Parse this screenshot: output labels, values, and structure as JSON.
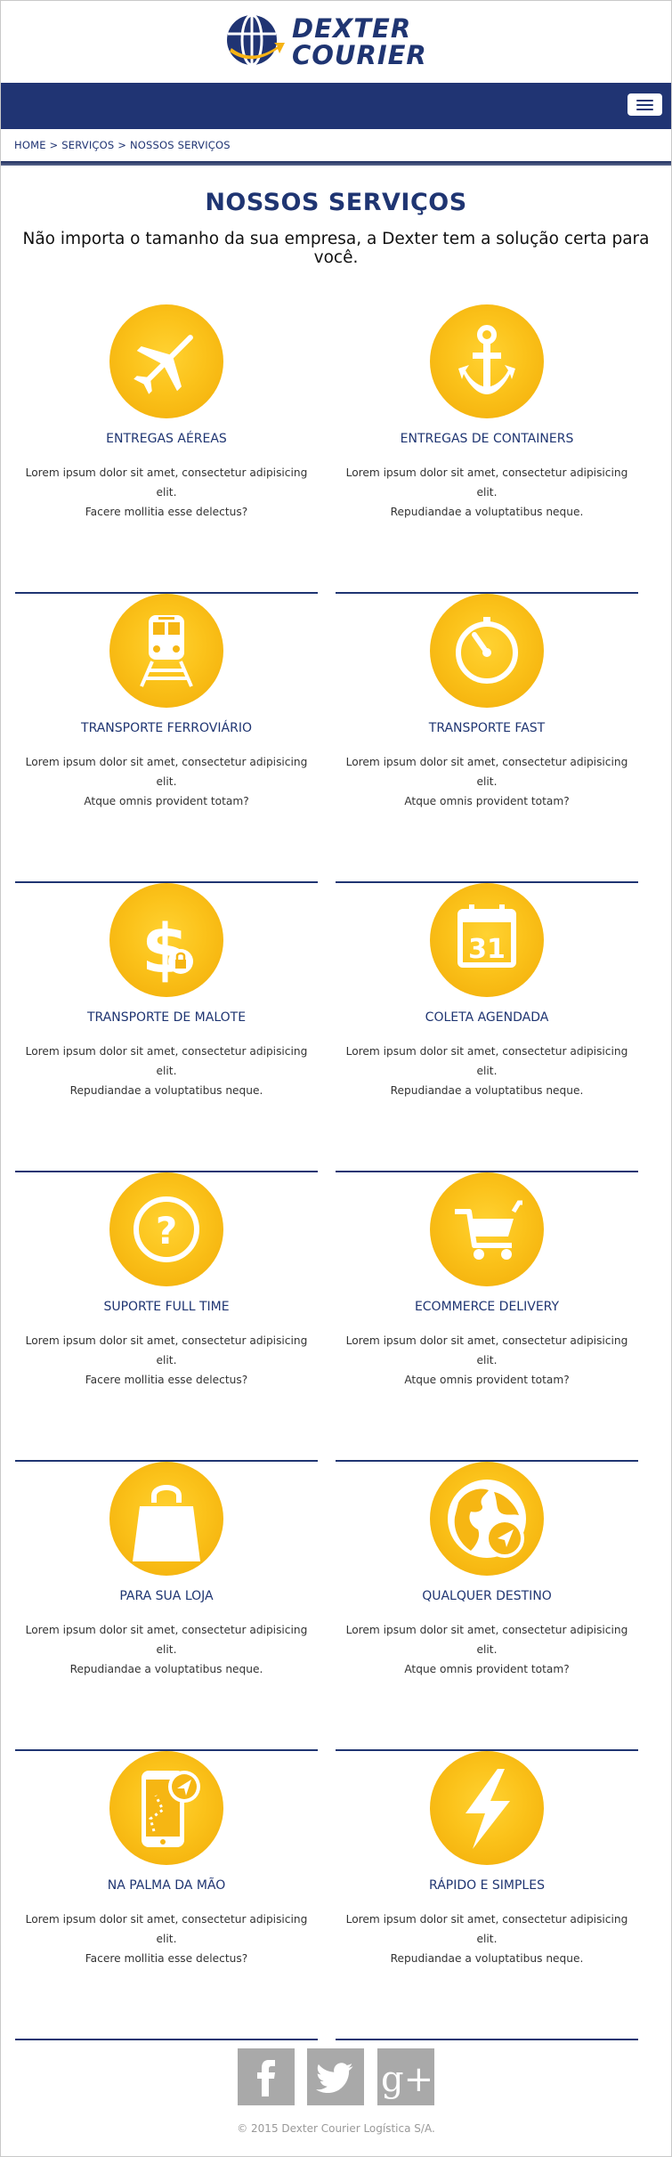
{
  "header": {
    "logo_line1": "DEXTER",
    "logo_line2": "COURIER",
    "menu_icon": "hamburger-icon"
  },
  "breadcrumb": "HOME > SERVIÇOS > NOSSOS SERVIÇOS",
  "main": {
    "title": "NOSSOS SERVIÇOS",
    "subtitle": "Não importa o tamanho da sua empresa, a Dexter tem a solução certa para você."
  },
  "services": [
    {
      "title": "ENTREGAS AÉREAS",
      "desc1": "Lorem ipsum dolor sit amet, consectetur adipisicing elit.",
      "desc2": "Facere mollitia esse delectus?",
      "icon": "airplane-icon"
    },
    {
      "title": "ENTREGAS DE CONTAINERS",
      "desc1": "Lorem ipsum dolor sit amet, consectetur adipisicing elit.",
      "desc2": "Repudiandae a voluptatibus neque.",
      "icon": "anchor-icon"
    },
    {
      "title": "TRANSPORTE FERROVIÁRIO",
      "desc1": "Lorem ipsum dolor sit amet, consectetur adipisicing elit.",
      "desc2": "Atque omnis provident totam?",
      "icon": "train-icon"
    },
    {
      "title": "TRANSPORTE FAST",
      "desc1": "Lorem ipsum dolor sit amet, consectetur adipisicing elit.",
      "desc2": "Atque omnis provident totam?",
      "icon": "stopwatch-icon"
    },
    {
      "title": "TRANSPORTE DE MALOTE",
      "desc1": "Lorem ipsum dolor sit amet, consectetur adipisicing elit.",
      "desc2": "Repudiandae a voluptatibus neque.",
      "icon": "dollar-lock-icon"
    },
    {
      "title": "COLETA AGENDADA",
      "desc1": "Lorem ipsum dolor sit amet, consectetur adipisicing elit.",
      "desc2": "Repudiandae a voluptatibus neque.",
      "icon": "calendar-icon",
      "icon_text": "31"
    },
    {
      "title": "SUPORTE FULL TIME",
      "desc1": "Lorem ipsum dolor sit amet, consectetur adipisicing elit.",
      "desc2": "Facere mollitia esse delectus?",
      "icon": "question-icon"
    },
    {
      "title": "ECOMMERCE DELIVERY",
      "desc1": "Lorem ipsum dolor sit amet, consectetur adipisicing elit.",
      "desc2": "Atque omnis provident totam?",
      "icon": "cart-icon"
    },
    {
      "title": "PARA SUA LOJA",
      "desc1": "Lorem ipsum dolor sit amet, consectetur adipisicing elit.",
      "desc2": "Repudiandae a voluptatibus neque.",
      "icon": "shopping-bag-icon"
    },
    {
      "title": "QUALQUER DESTINO",
      "desc1": "Lorem ipsum dolor sit amet, consectetur adipisicing elit.",
      "desc2": "Atque omnis provident totam?",
      "icon": "globe-icon"
    },
    {
      "title": "NA PALMA DA MÃO",
      "desc1": "Lorem ipsum dolor sit amet, consectetur adipisicing elit.",
      "desc2": "Facere mollitia esse delectus?",
      "icon": "phone-map-icon"
    },
    {
      "title": "RÁPIDO E SIMPLES",
      "desc1": "Lorem ipsum dolor sit amet, consectetur adipisicing elit.",
      "desc2": "Repudiandae a voluptatibus neque.",
      "icon": "lightning-icon"
    }
  ],
  "footer": {
    "social": [
      {
        "name": "facebook",
        "icon": "facebook-icon"
      },
      {
        "name": "twitter",
        "icon": "twitter-icon"
      },
      {
        "name": "google-plus",
        "icon": "google-plus-icon",
        "label": "g+"
      }
    ],
    "copyright": "© 2015 Dexter Courier Logística S/A."
  },
  "colors": {
    "brand_blue": "#203473",
    "icon_yellow": "#fbc21a",
    "social_gray": "#a9a9a9"
  }
}
